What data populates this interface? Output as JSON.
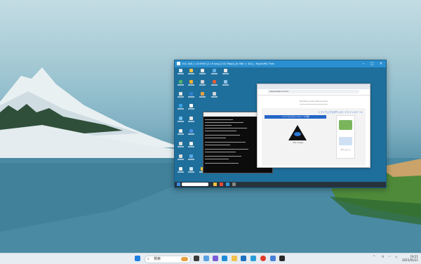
{
  "remote_window": {
    "title": "192.168.1.10:5900 [2.19 fps] [2.02 Mbps] [0.980 × 341] - RoyalVNC Free",
    "min_glyph": "–",
    "max_glyph": "□",
    "close_glyph": "✕"
  },
  "browser": {
    "address": "www.example.com/vnc",
    "page_title": "Remote Access Setup Guide",
    "heading": "ソフトウェアのダウンロードとインストール",
    "banner": "ソフトウェアのインストール手順",
    "caption": "VNC Viewer",
    "side_note": "ダウンロード"
  },
  "taskbar": {
    "search_placeholder": "検索",
    "time": "19:21",
    "date": "2025/05/21"
  },
  "colors": {
    "accent": "#2a8fd0",
    "taskbar": "#e6ecf1"
  }
}
